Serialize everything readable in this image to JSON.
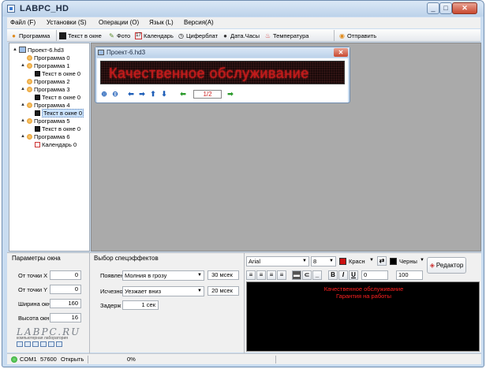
{
  "window": {
    "title": "LABPC_HD"
  },
  "menu": [
    "Файл (F)",
    "Установки (S)",
    "Операции (O)",
    "Язык (L)",
    "Версия(A)"
  ],
  "toolbar": {
    "items": [
      {
        "label": "Программа",
        "icon": "program-icon"
      },
      {
        "label": "Текст в окне",
        "icon": "text-window-icon"
      },
      {
        "label": "Фото",
        "icon": "photo-icon"
      },
      {
        "label": "Календарь",
        "icon": "calendar-icon"
      },
      {
        "label": "Циферблат",
        "icon": "clock-icon"
      },
      {
        "label": "Дата.Часы",
        "icon": "datetime-icon"
      },
      {
        "label": "Температура",
        "icon": "temperature-icon"
      }
    ],
    "send_label": "Отправить"
  },
  "tree": [
    {
      "label": "Проект-6.hd3",
      "level": 0,
      "type": "project",
      "expander": "▲"
    },
    {
      "label": "Программа 0",
      "level": 1,
      "type": "program",
      "expander": ""
    },
    {
      "label": "Программа 1",
      "level": 1,
      "type": "program",
      "expander": "▲"
    },
    {
      "label": "Текст в окне 0",
      "level": 2,
      "type": "text",
      "expander": ""
    },
    {
      "label": "Программа 2",
      "level": 1,
      "type": "program",
      "expander": ""
    },
    {
      "label": "Программа 3",
      "level": 1,
      "type": "program",
      "expander": "▲"
    },
    {
      "label": "Текст в окне 0",
      "level": 2,
      "type": "text",
      "expander": ""
    },
    {
      "label": "Программа 4",
      "level": 1,
      "type": "program",
      "expander": "▲"
    },
    {
      "label": "Текст в окне 0",
      "level": 2,
      "type": "text",
      "expander": "",
      "selected": true
    },
    {
      "label": "Программа 5",
      "level": 1,
      "type": "program",
      "expander": "▲"
    },
    {
      "label": "Текст в окне 0",
      "level": 2,
      "type": "text",
      "expander": ""
    },
    {
      "label": "Программа 6",
      "level": 1,
      "type": "program",
      "expander": "▲"
    },
    {
      "label": "Календарь 0",
      "level": 2,
      "type": "calendar",
      "expander": ""
    }
  ],
  "child_window": {
    "title": "Проект-6.hd3",
    "led_text": "Качественное обслуживание",
    "page": "1/2"
  },
  "params": {
    "header": "Параметры окна",
    "rows": [
      {
        "label": "От точки X",
        "value": "0"
      },
      {
        "label": "От точки Y",
        "value": "0"
      },
      {
        "label": "Ширина окн",
        "value": "160"
      },
      {
        "label": "Высота окн",
        "value": "16"
      }
    ],
    "logo": "LABPC.RU",
    "logo_sub": "компьютерная лаборатория"
  },
  "effects": {
    "header": "Выбор спецэффектов",
    "appear_label": "Появлен",
    "appear_value": "Молния в грозу",
    "appear_time": "30 мсек",
    "vanish_label": "Исчезно",
    "vanish_value": "Уезжает вниз",
    "vanish_time": "20 мсек",
    "delay_label": "Задерж",
    "delay_value": "1 сек"
  },
  "editor": {
    "font": "Arial",
    "size": "8",
    "fg_color_name": "Красн",
    "bg_color_name": "Черны",
    "fg_color": "#cc1111",
    "bg_color": "#000000",
    "spacing": "0",
    "scale": "100",
    "redactor_label": "Редактор",
    "lines": [
      "Качественное обслуживание",
      "Гарантия на работы"
    ]
  },
  "status": {
    "port": "COM1",
    "baud": "57600",
    "state": "Открыть",
    "progress": "0%"
  }
}
